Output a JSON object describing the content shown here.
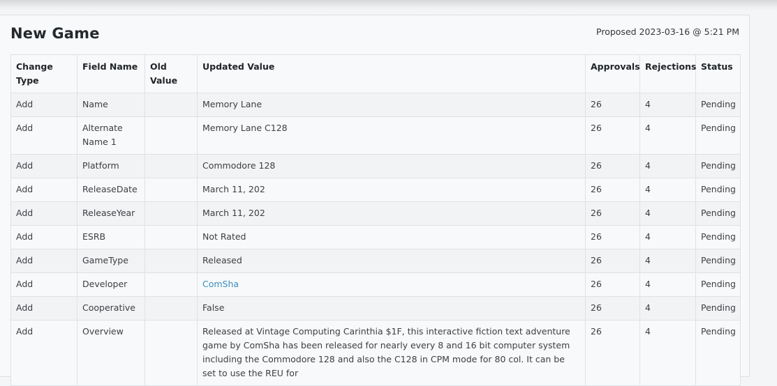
{
  "page": {
    "title": "New Game",
    "proposed": "Proposed 2023-03-16 @ 5:21 PM"
  },
  "table": {
    "headers": [
      "Change Type",
      "Field Name",
      "Old Value",
      "Updated Value",
      "Approvals",
      "Rejections",
      "Status"
    ],
    "rows": [
      {
        "change": "Add",
        "field": "Name",
        "old": "",
        "updated": "Memory Lane",
        "approvals": "26",
        "rejections": "4",
        "status": "Pending"
      },
      {
        "change": "Add",
        "field": "Alternate Name 1",
        "old": "",
        "updated": "Memory Lane C128",
        "approvals": "26",
        "rejections": "4",
        "status": "Pending"
      },
      {
        "change": "Add",
        "field": "Platform",
        "old": "",
        "updated": "Commodore 128",
        "approvals": "26",
        "rejections": "4",
        "status": "Pending"
      },
      {
        "change": "Add",
        "field": "ReleaseDate",
        "old": "",
        "updated": "March 11, 202",
        "approvals": "26",
        "rejections": "4",
        "status": "Pending"
      },
      {
        "change": "Add",
        "field": "ReleaseYear",
        "old": "",
        "updated": "March 11, 202",
        "approvals": "26",
        "rejections": "4",
        "status": "Pending"
      },
      {
        "change": "Add",
        "field": "ESRB",
        "old": "",
        "updated": "Not Rated",
        "approvals": "26",
        "rejections": "4",
        "status": "Pending"
      },
      {
        "change": "Add",
        "field": "GameType",
        "old": "",
        "updated": "Released",
        "approvals": "26",
        "rejections": "4",
        "status": "Pending"
      },
      {
        "change": "Add",
        "field": "Developer",
        "old": "",
        "updated": "ComSha",
        "approvals": "26",
        "rejections": "4",
        "status": "Pending"
      },
      {
        "change": "Add",
        "field": "Cooperative",
        "old": "",
        "updated": "False",
        "approvals": "26",
        "rejections": "4",
        "status": "Pending"
      },
      {
        "change": "Add",
        "field": "Overview",
        "old": "",
        "updated": "Released at Vintage Computing Carinthia $1F, this interactive fiction text adventure game by ComSha has been released for nearly every 8 and 16 bit computer system including the Commodore 128 and also the C128 in CPM mode for 80 col. It can be set to use the REU for",
        "approvals": "26",
        "rejections": "4",
        "status": "Pending"
      }
    ]
  }
}
